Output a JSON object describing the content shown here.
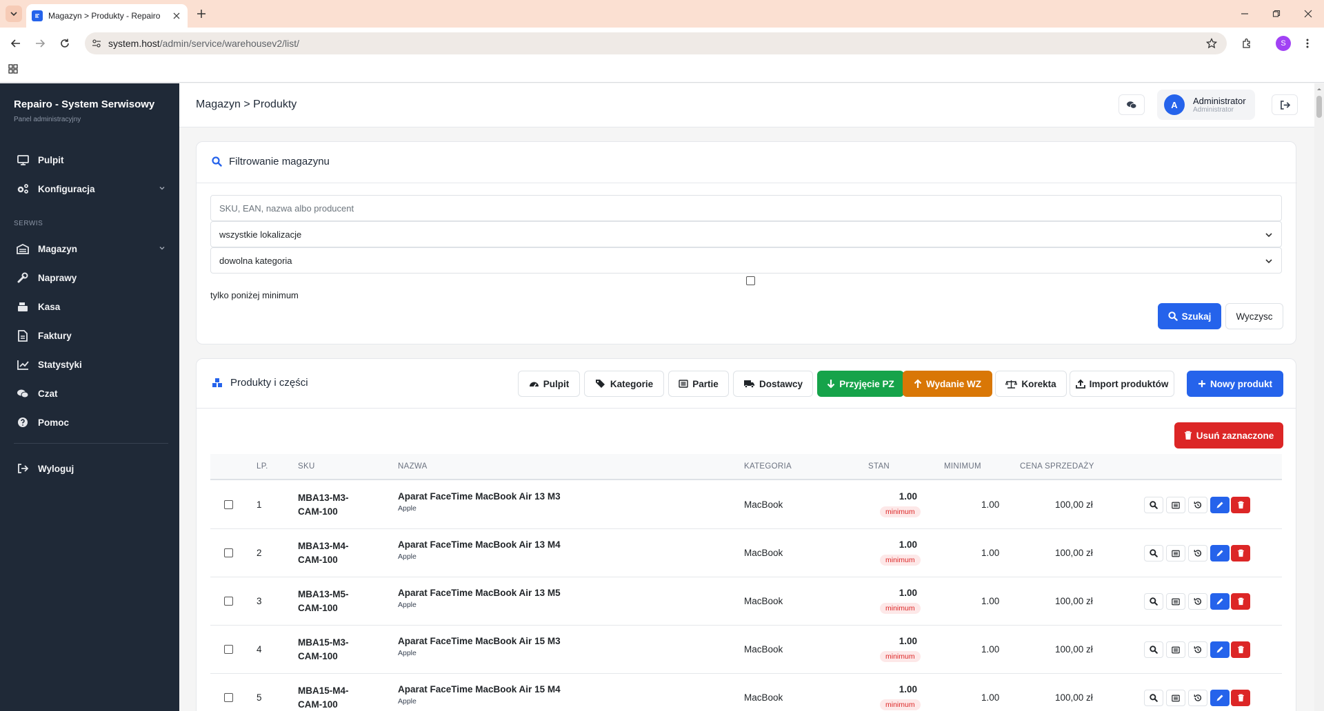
{
  "browser": {
    "tab_title": "Magazyn > Produkty - Repairo",
    "url_host": "system.host",
    "url_path": "/admin/service/warehousev2/list/",
    "profile_initial": "S"
  },
  "sidebar": {
    "brand": "Repairo - System Serwisowy",
    "brand_sub": "Panel administracyjny",
    "section_label": "SERWIS",
    "items": [
      {
        "label": "Pulpit",
        "icon": "monitor-icon"
      },
      {
        "label": "Konfiguracja",
        "icon": "cogs-icon"
      },
      {
        "label": "Magazyn",
        "icon": "warehouse-icon"
      },
      {
        "label": "Naprawy",
        "icon": "wrench-icon"
      },
      {
        "label": "Kasa",
        "icon": "cash-register-icon"
      },
      {
        "label": "Faktury",
        "icon": "invoice-icon"
      },
      {
        "label": "Statystyki",
        "icon": "chart-line-icon"
      },
      {
        "label": "Czat",
        "icon": "chat-icon"
      },
      {
        "label": "Pomoc",
        "icon": "question-icon"
      },
      {
        "label": "Wyloguj",
        "icon": "logout-icon"
      }
    ]
  },
  "header": {
    "breadcrumb": "Magazyn > Produkty",
    "user_initial": "A",
    "user_name": "Administrator",
    "user_role": "Administrator"
  },
  "filter": {
    "title": "Filtrowanie magazynu",
    "search_placeholder": "SKU, EAN, nazwa albo producent",
    "location_value": "wszystkie lokalizacje",
    "category_value": "dowolna kategoria",
    "below_min_label": "tylko poniżej minimum",
    "search_button": "Szukaj",
    "clear_button": "Wyczysc"
  },
  "products": {
    "title": "Produkty i części",
    "toolbar": {
      "pulpit": "Pulpit",
      "kategorie": "Kategorie",
      "partie": "Partie",
      "dostawcy": "Dostawcy",
      "przyjecie": "Przyjęcie PZ",
      "wydanie": "Wydanie WZ",
      "korekta": "Korekta",
      "import": "Import produktów",
      "nowy": "Nowy produkt"
    },
    "delete_selected": "Usuń zaznaczone",
    "columns": {
      "lp": "LP.",
      "sku": "SKU",
      "nazwa": "NAZWA",
      "kategoria": "KATEGORIA",
      "stan": "STAN",
      "minimum": "MINIMUM",
      "cena": "CENA SPRZEDAŻY"
    },
    "rows": [
      {
        "lp": "1",
        "sku1": "MBA13-M3-",
        "sku2": "CAM-100",
        "name": "Aparat FaceTime MacBook Air 13 M3",
        "brand": "Apple",
        "category": "MacBook",
        "stan": "1.00",
        "badge": "minimum",
        "minimum": "1.00",
        "price": "100,00 zł"
      },
      {
        "lp": "2",
        "sku1": "MBA13-M4-",
        "sku2": "CAM-100",
        "name": "Aparat FaceTime MacBook Air 13 M4",
        "brand": "Apple",
        "category": "MacBook",
        "stan": "1.00",
        "badge": "minimum",
        "minimum": "1.00",
        "price": "100,00 zł"
      },
      {
        "lp": "3",
        "sku1": "MBA13-M5-",
        "sku2": "CAM-100",
        "name": "Aparat FaceTime MacBook Air 13 M5",
        "brand": "Apple",
        "category": "MacBook",
        "stan": "1.00",
        "badge": "minimum",
        "minimum": "1.00",
        "price": "100,00 zł"
      },
      {
        "lp": "4",
        "sku1": "MBA15-M3-",
        "sku2": "CAM-100",
        "name": "Aparat FaceTime MacBook Air 15 M3",
        "brand": "Apple",
        "category": "MacBook",
        "stan": "1.00",
        "badge": "minimum",
        "minimum": "1.00",
        "price": "100,00 zł"
      },
      {
        "lp": "5",
        "sku1": "MBA15-M4-",
        "sku2": "CAM-100",
        "name": "Aparat FaceTime MacBook Air 15 M4",
        "brand": "Apple",
        "category": "MacBook",
        "stan": "1.00",
        "badge": "minimum",
        "minimum": "1.00",
        "price": "100,00 zł"
      }
    ]
  },
  "colors": {
    "sidebar_bg": "#1f2937",
    "primary": "#2563eb",
    "success": "#16a34a",
    "warning": "#d97706",
    "danger": "#dc2626"
  }
}
